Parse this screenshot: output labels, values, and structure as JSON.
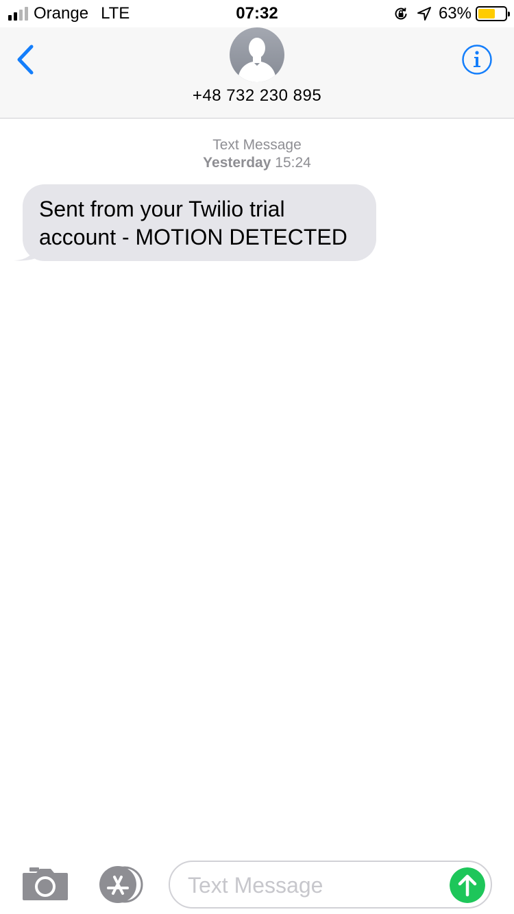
{
  "status_bar": {
    "carrier": "Orange",
    "network": "LTE",
    "time": "07:32",
    "battery_percent": "63%",
    "battery_level": 0.63,
    "battery_color": "#ffcc00",
    "signal_bars_filled": 2,
    "signal_bars_total": 4
  },
  "header": {
    "contact": "+48 732 230 895",
    "back_icon": "chevron-left-icon",
    "info_icon": "info-icon",
    "accent": "#147efb"
  },
  "conversation": {
    "message_type": "Text Message",
    "day": "Yesterday",
    "time": "15:24",
    "messages": [
      {
        "direction": "incoming",
        "text": "Sent from your Twilio trial account - MOTION DETECTED",
        "bubble_color": "#e5e5ea"
      }
    ]
  },
  "compose": {
    "placeholder": "Text Message",
    "camera_icon": "camera-icon",
    "apps_icon": "app-store-icon",
    "send_icon": "send-arrow-icon",
    "send_color": "#1ec65a",
    "icon_color": "#8e8e93"
  }
}
